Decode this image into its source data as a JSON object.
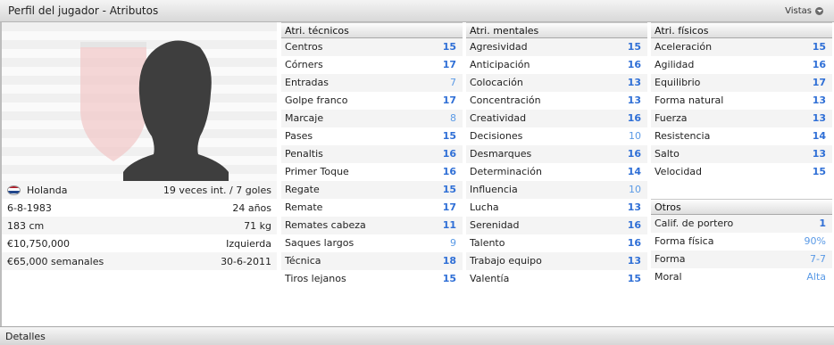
{
  "window": {
    "title": "Perfil del jugador - Atributos",
    "views_label": "Vistas"
  },
  "player": {
    "nationality": "Holanda",
    "caps": "19 veces int. / 7 goles",
    "birthdate": "6-8-1983",
    "age": "24 años",
    "height": "183 cm",
    "weight": "71 kg",
    "value": "€10,750,000",
    "foot": "Izquierda",
    "wage": "€65,000 semanales",
    "contract": "30-6-2011",
    "flag_colors": [
      "#ae1c28",
      "#ffffff",
      "#21468b"
    ]
  },
  "technical": {
    "header": "Atri. técnicos",
    "items": [
      {
        "label": "Centros",
        "value": "15"
      },
      {
        "label": "Córners",
        "value": "17"
      },
      {
        "label": "Entradas",
        "value": "7"
      },
      {
        "label": "Golpe franco",
        "value": "17"
      },
      {
        "label": "Marcaje",
        "value": "8"
      },
      {
        "label": "Pases",
        "value": "15"
      },
      {
        "label": "Penaltis",
        "value": "16"
      },
      {
        "label": "Primer Toque",
        "value": "16"
      },
      {
        "label": "Regate",
        "value": "15"
      },
      {
        "label": "Remate",
        "value": "17"
      },
      {
        "label": "Remates cabeza",
        "value": "11"
      },
      {
        "label": "Saques largos",
        "value": "9"
      },
      {
        "label": "Técnica",
        "value": "18"
      },
      {
        "label": "Tiros lejanos",
        "value": "15"
      }
    ]
  },
  "mental": {
    "header": "Atri. mentales",
    "items": [
      {
        "label": "Agresividad",
        "value": "15"
      },
      {
        "label": "Anticipación",
        "value": "16"
      },
      {
        "label": "Colocación",
        "value": "13"
      },
      {
        "label": "Concentración",
        "value": "13"
      },
      {
        "label": "Creatividad",
        "value": "16"
      },
      {
        "label": "Decisiones",
        "value": "10"
      },
      {
        "label": "Desmarques",
        "value": "16"
      },
      {
        "label": "Determinación",
        "value": "14"
      },
      {
        "label": "Influencia",
        "value": "10"
      },
      {
        "label": "Lucha",
        "value": "13"
      },
      {
        "label": "Serenidad",
        "value": "16"
      },
      {
        "label": "Talento",
        "value": "16"
      },
      {
        "label": "Trabajo equipo",
        "value": "13"
      },
      {
        "label": "Valentía",
        "value": "15"
      }
    ]
  },
  "physical": {
    "header": "Atri. físicos",
    "items": [
      {
        "label": "Aceleración",
        "value": "15"
      },
      {
        "label": "Agilidad",
        "value": "16"
      },
      {
        "label": "Equilibrio",
        "value": "17"
      },
      {
        "label": "Forma natural",
        "value": "13"
      },
      {
        "label": "Fuerza",
        "value": "13"
      },
      {
        "label": "Resistencia",
        "value": "14"
      },
      {
        "label": "Salto",
        "value": "13"
      },
      {
        "label": "Velocidad",
        "value": "15"
      }
    ]
  },
  "other": {
    "header": "Otros",
    "items": [
      {
        "label": "Calif. de portero",
        "value": "1"
      },
      {
        "label": "Forma física",
        "value": "90%"
      },
      {
        "label": "Forma",
        "value": "7-7"
      },
      {
        "label": "Moral",
        "value": "Alta"
      }
    ]
  },
  "footer": {
    "label": "Detalles"
  }
}
